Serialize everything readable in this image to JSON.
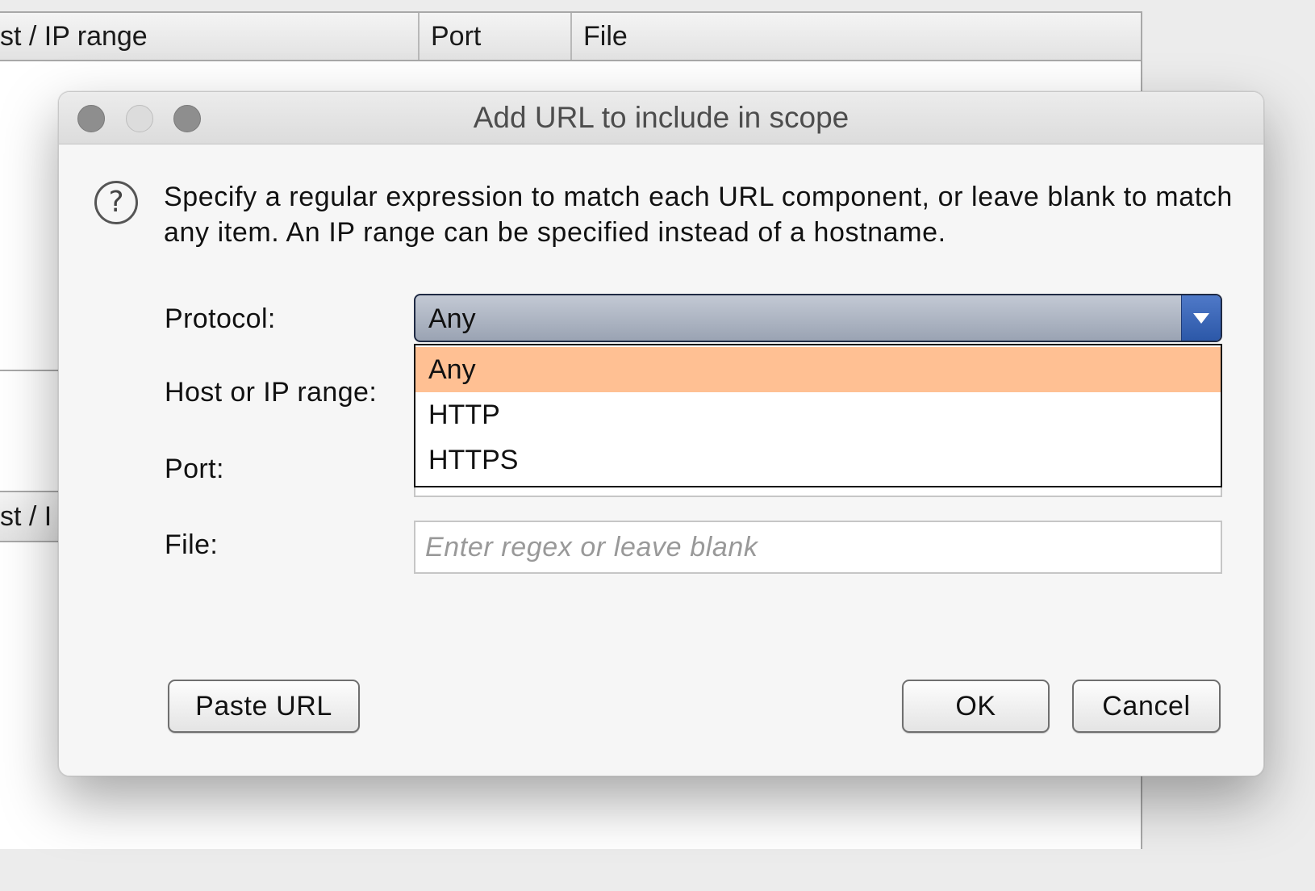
{
  "background": {
    "table_headers": [
      "st / IP range",
      "Port",
      "File"
    ],
    "second_header_fragment": "st / I"
  },
  "dialog": {
    "title": "Add URL to include in scope",
    "help_icon_glyph": "?",
    "description": "Specify a regular expression to match each URL component, or leave blank to match any item. An IP range can be specified instead of a hostname.",
    "labels": {
      "protocol": "Protocol:",
      "host": "Host or IP range:",
      "port": "Port:",
      "file": "File:"
    },
    "protocol_select": {
      "value": "Any",
      "options": [
        "Any",
        "HTTP",
        "HTTPS"
      ],
      "highlighted": "Any"
    },
    "file_field": {
      "value": "",
      "placeholder": "Enter regex or leave blank"
    },
    "buttons": {
      "paste": "Paste URL",
      "ok": "OK",
      "cancel": "Cancel"
    }
  },
  "colors": {
    "highlight": "#ffc093",
    "select_arrow": "#2c58a8"
  }
}
